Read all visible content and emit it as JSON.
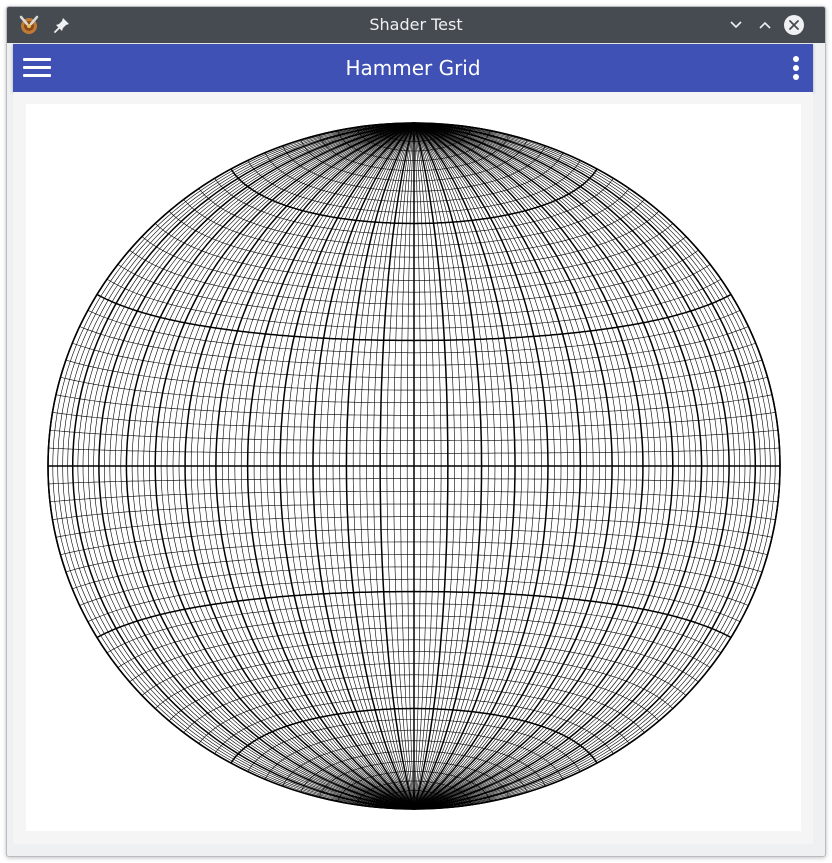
{
  "window": {
    "title": "Shader Test",
    "app_icon": "kde-app-icon",
    "buttons": [
      "pin-icon",
      "minimize-icon",
      "maximize-icon",
      "close-icon"
    ]
  },
  "appbar": {
    "title": "Hammer Grid",
    "menu_icon": "hamburger-menu-icon",
    "more_icon": "more-vert-icon",
    "color": "#3f51b5"
  },
  "projection": {
    "name": "Hammer",
    "meridian_step_deg": 3,
    "parallel_step_deg": 3,
    "major_meridian_step_deg": 15,
    "major_parallel_step_deg": 30
  }
}
